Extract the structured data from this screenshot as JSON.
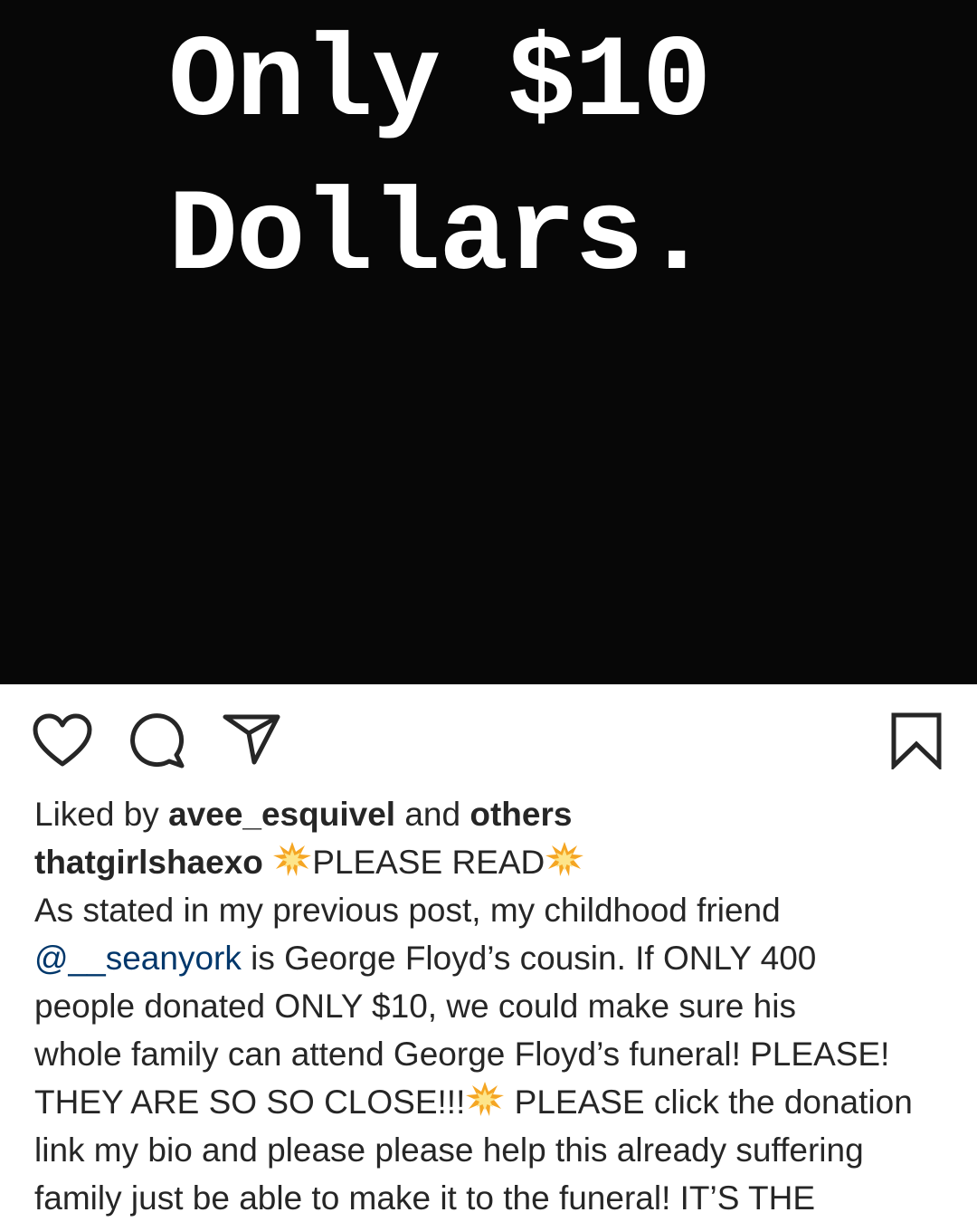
{
  "post": {
    "image_text_line1": "Only $10",
    "image_text_line2": "Dollars."
  },
  "actions": {
    "like_icon": "heart-icon",
    "comment_icon": "comment-bubble-icon",
    "share_icon": "paper-plane-icon",
    "save_icon": "bookmark-icon"
  },
  "likes": {
    "prefix": "Liked by",
    "user": "avee_esquivel",
    "connector": "and",
    "others": "others"
  },
  "caption": {
    "username": "thatgirlshaexo",
    "headline": "PLEASE READ",
    "line1": "As stated in my previous post, my childhood friend",
    "mention": "@__seanyork",
    "line2_rest": " is George Floyd’s cousin. If ONLY 400",
    "line3": "people donated ONLY $10, we could make sure his",
    "line4": "whole family can attend George Floyd’s funeral! PLEASE!",
    "line5_a": "THEY ARE SO SO CLOSE!!!",
    "line5_b": " PLEASE click the donation",
    "line6": "link my bio and please please help this already suffering",
    "line7": "family just be able to make it to the funeral! IT’S THE"
  },
  "colors": {
    "image_background": "#070707",
    "text": "#262626",
    "mention": "#00376b",
    "burst_emoji": "#f5a623"
  }
}
